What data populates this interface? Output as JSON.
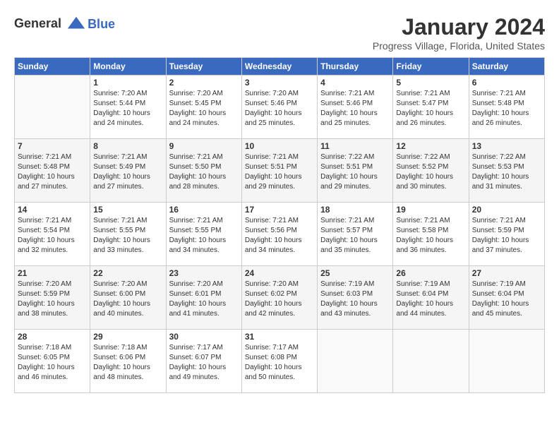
{
  "logo": {
    "line1": "General",
    "line2": "Blue"
  },
  "title": "January 2024",
  "location": "Progress Village, Florida, United States",
  "days_of_week": [
    "Sunday",
    "Monday",
    "Tuesday",
    "Wednesday",
    "Thursday",
    "Friday",
    "Saturday"
  ],
  "weeks": [
    [
      {
        "day": "",
        "sunrise": "",
        "sunset": "",
        "daylight": ""
      },
      {
        "day": "1",
        "sunrise": "7:20 AM",
        "sunset": "5:44 PM",
        "daylight": "10 hours and 24 minutes."
      },
      {
        "day": "2",
        "sunrise": "7:20 AM",
        "sunset": "5:45 PM",
        "daylight": "10 hours and 24 minutes."
      },
      {
        "day": "3",
        "sunrise": "7:20 AM",
        "sunset": "5:46 PM",
        "daylight": "10 hours and 25 minutes."
      },
      {
        "day": "4",
        "sunrise": "7:21 AM",
        "sunset": "5:46 PM",
        "daylight": "10 hours and 25 minutes."
      },
      {
        "day": "5",
        "sunrise": "7:21 AM",
        "sunset": "5:47 PM",
        "daylight": "10 hours and 26 minutes."
      },
      {
        "day": "6",
        "sunrise": "7:21 AM",
        "sunset": "5:48 PM",
        "daylight": "10 hours and 26 minutes."
      }
    ],
    [
      {
        "day": "7",
        "sunrise": "7:21 AM",
        "sunset": "5:48 PM",
        "daylight": "10 hours and 27 minutes."
      },
      {
        "day": "8",
        "sunrise": "7:21 AM",
        "sunset": "5:49 PM",
        "daylight": "10 hours and 27 minutes."
      },
      {
        "day": "9",
        "sunrise": "7:21 AM",
        "sunset": "5:50 PM",
        "daylight": "10 hours and 28 minutes."
      },
      {
        "day": "10",
        "sunrise": "7:21 AM",
        "sunset": "5:51 PM",
        "daylight": "10 hours and 29 minutes."
      },
      {
        "day": "11",
        "sunrise": "7:22 AM",
        "sunset": "5:51 PM",
        "daylight": "10 hours and 29 minutes."
      },
      {
        "day": "12",
        "sunrise": "7:22 AM",
        "sunset": "5:52 PM",
        "daylight": "10 hours and 30 minutes."
      },
      {
        "day": "13",
        "sunrise": "7:22 AM",
        "sunset": "5:53 PM",
        "daylight": "10 hours and 31 minutes."
      }
    ],
    [
      {
        "day": "14",
        "sunrise": "7:21 AM",
        "sunset": "5:54 PM",
        "daylight": "10 hours and 32 minutes."
      },
      {
        "day": "15",
        "sunrise": "7:21 AM",
        "sunset": "5:55 PM",
        "daylight": "10 hours and 33 minutes."
      },
      {
        "day": "16",
        "sunrise": "7:21 AM",
        "sunset": "5:55 PM",
        "daylight": "10 hours and 34 minutes."
      },
      {
        "day": "17",
        "sunrise": "7:21 AM",
        "sunset": "5:56 PM",
        "daylight": "10 hours and 34 minutes."
      },
      {
        "day": "18",
        "sunrise": "7:21 AM",
        "sunset": "5:57 PM",
        "daylight": "10 hours and 35 minutes."
      },
      {
        "day": "19",
        "sunrise": "7:21 AM",
        "sunset": "5:58 PM",
        "daylight": "10 hours and 36 minutes."
      },
      {
        "day": "20",
        "sunrise": "7:21 AM",
        "sunset": "5:59 PM",
        "daylight": "10 hours and 37 minutes."
      }
    ],
    [
      {
        "day": "21",
        "sunrise": "7:20 AM",
        "sunset": "5:59 PM",
        "daylight": "10 hours and 38 minutes."
      },
      {
        "day": "22",
        "sunrise": "7:20 AM",
        "sunset": "6:00 PM",
        "daylight": "10 hours and 40 minutes."
      },
      {
        "day": "23",
        "sunrise": "7:20 AM",
        "sunset": "6:01 PM",
        "daylight": "10 hours and 41 minutes."
      },
      {
        "day": "24",
        "sunrise": "7:20 AM",
        "sunset": "6:02 PM",
        "daylight": "10 hours and 42 minutes."
      },
      {
        "day": "25",
        "sunrise": "7:19 AM",
        "sunset": "6:03 PM",
        "daylight": "10 hours and 43 minutes."
      },
      {
        "day": "26",
        "sunrise": "7:19 AM",
        "sunset": "6:04 PM",
        "daylight": "10 hours and 44 minutes."
      },
      {
        "day": "27",
        "sunrise": "7:19 AM",
        "sunset": "6:04 PM",
        "daylight": "10 hours and 45 minutes."
      }
    ],
    [
      {
        "day": "28",
        "sunrise": "7:18 AM",
        "sunset": "6:05 PM",
        "daylight": "10 hours and 46 minutes."
      },
      {
        "day": "29",
        "sunrise": "7:18 AM",
        "sunset": "6:06 PM",
        "daylight": "10 hours and 48 minutes."
      },
      {
        "day": "30",
        "sunrise": "7:17 AM",
        "sunset": "6:07 PM",
        "daylight": "10 hours and 49 minutes."
      },
      {
        "day": "31",
        "sunrise": "7:17 AM",
        "sunset": "6:08 PM",
        "daylight": "10 hours and 50 minutes."
      },
      {
        "day": "",
        "sunrise": "",
        "sunset": "",
        "daylight": ""
      },
      {
        "day": "",
        "sunrise": "",
        "sunset": "",
        "daylight": ""
      },
      {
        "day": "",
        "sunrise": "",
        "sunset": "",
        "daylight": ""
      }
    ]
  ]
}
